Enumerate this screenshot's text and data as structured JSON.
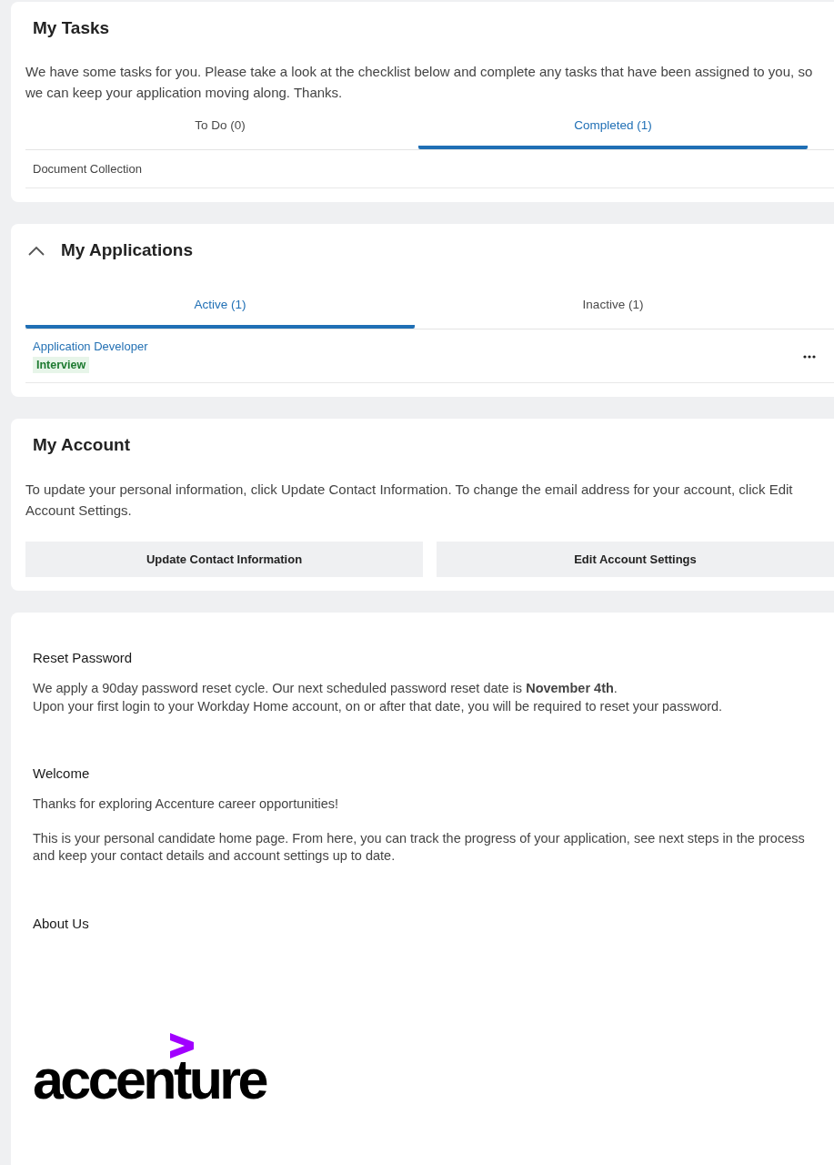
{
  "tasks_card": {
    "title": "My Tasks",
    "description": "We have some tasks for you. Please take a look at the checklist below and complete any tasks that have been assigned to you, so we can keep your application moving along. Thanks.",
    "tabs": [
      {
        "label": "To Do (0)",
        "selected": false
      },
      {
        "label": "Completed (1)",
        "selected": true
      }
    ],
    "items": [
      "Document Collection"
    ]
  },
  "applications_card": {
    "title": "My Applications",
    "expanded": true,
    "tabs": [
      {
        "label": "Active (1)",
        "selected": true
      },
      {
        "label": "Inactive (1)",
        "selected": false
      }
    ],
    "applications": [
      {
        "job_title": "Application Developer",
        "status": "Interview"
      }
    ]
  },
  "account_card": {
    "title": "My Account",
    "description": "To update your personal information, click Update Contact Information. To change the email address for your account, click Edit Account Settings.",
    "buttons": [
      "Update Contact Information",
      "Edit Account Settings"
    ]
  },
  "info_card": {
    "sections": [
      {
        "heading": "Reset Password",
        "paragraphs": [
          "We apply a 90day password reset cycle. Our next scheduled password reset date is **November 4th**.\nUpon your first login to your Workday Home account, on or after that date, you will be required to reset your password."
        ]
      },
      {
        "heading": "Welcome",
        "paragraphs": [
          "Thanks for exploring Accenture career opportunities!",
          "This is your personal candidate home page. From here, you can track the progress of your application, see next steps in the process and keep your contact details and account settings up to date."
        ]
      },
      {
        "heading": "About Us"
      }
    ],
    "logo": {
      "wordmark": "accenture"
    }
  }
}
